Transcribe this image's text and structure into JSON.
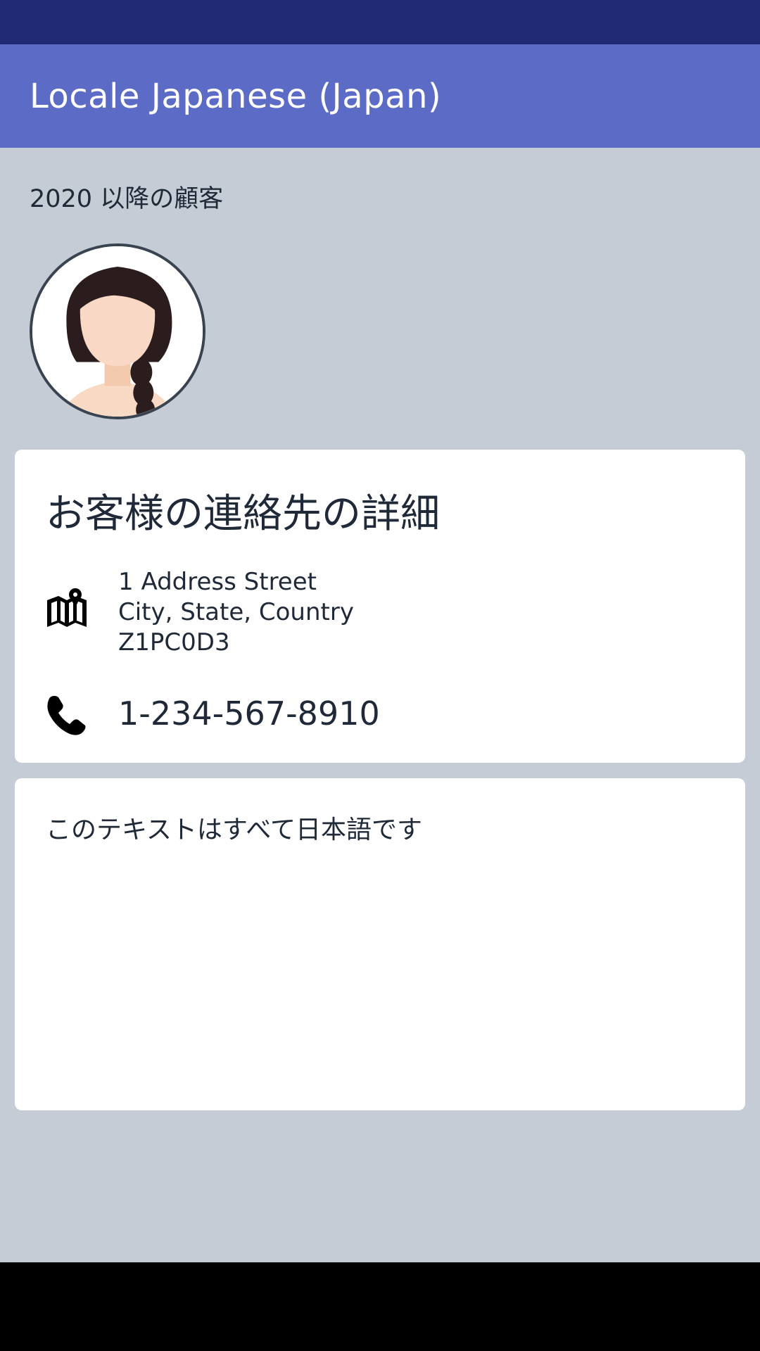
{
  "colors": {
    "status_bar": "#212b75",
    "app_bar": "#5c6bc6",
    "background": "#c5ccd5",
    "card": "#ffffff",
    "text": "#1f2937",
    "nav_bar": "#000000"
  },
  "app_bar": {
    "title": "Locale Japanese (Japan)"
  },
  "profile": {
    "since_text": "2020 以降の顧客",
    "avatar_icon": "avatar-woman-braid"
  },
  "contact_card": {
    "heading": "お客様の連絡先の詳細",
    "address": {
      "icon": "map-icon",
      "line1": "1 Address Street",
      "line2": "City, State, Country",
      "line3": "Z1PC0D3"
    },
    "phone": {
      "icon": "phone-icon",
      "number": "1-234-567-8910"
    }
  },
  "text_card": {
    "body": "このテキストはすべて日本語です"
  }
}
